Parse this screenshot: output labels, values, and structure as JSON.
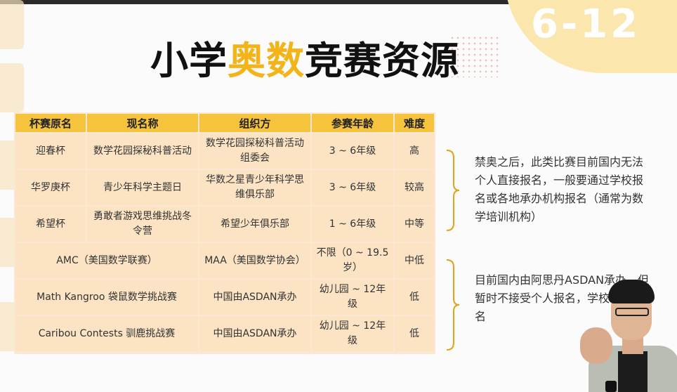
{
  "title": {
    "part1": "小学",
    "highlight": "奥数",
    "part2": "竞赛资源"
  },
  "badge": "6-12",
  "colors": {
    "accent": "#f2b418",
    "header_bg": "#f5c33c",
    "cell_bg": "#fbe3c3"
  },
  "table": {
    "headers": [
      "杯赛原名",
      "现名称",
      "组织方",
      "参赛年龄",
      "难度"
    ],
    "rows": [
      {
        "orig": "迎春杯",
        "name": "数学花园探秘科普活动",
        "org": "数学花园探秘科普活动组委会",
        "age": "3 ~ 6年级",
        "level": "高"
      },
      {
        "orig": "华罗庚杯",
        "name": "青少年科学主题日",
        "org": "华数之星青少年科学思维俱乐部",
        "age": "3 ~ 6年级",
        "level": "较高"
      },
      {
        "orig": "希望杯",
        "name": "勇敢者游戏思维挑战冬令营",
        "org": "希望少年俱乐部",
        "age": "1 ~ 6年级",
        "level": "中等"
      },
      {
        "merged": "AMC（美国数学联赛）",
        "org": "MAA（美国数学协会）",
        "age": "不限（0 ~ 19.5岁）",
        "level": "中低"
      },
      {
        "merged": "Math Kangroo 袋鼠数学挑战赛",
        "org": "中国由ASDAN承办",
        "age": "幼儿园 ~ 12年级",
        "level": "低"
      },
      {
        "merged": "Caribou Contests 驯鹿挑战赛",
        "org": "中国由ASDAN承办",
        "age": "幼儿园 ~ 12年级",
        "level": "低"
      }
    ]
  },
  "notes": [
    "禁奥之后，此类比赛目前国内无法个人直接报名，一般要通过学校报名或各地承办机构报名（通常为数学培训机构）",
    "目前国内由阿思丹ASDAN承办，但暂时不接受个人报名，学校合作报名"
  ]
}
